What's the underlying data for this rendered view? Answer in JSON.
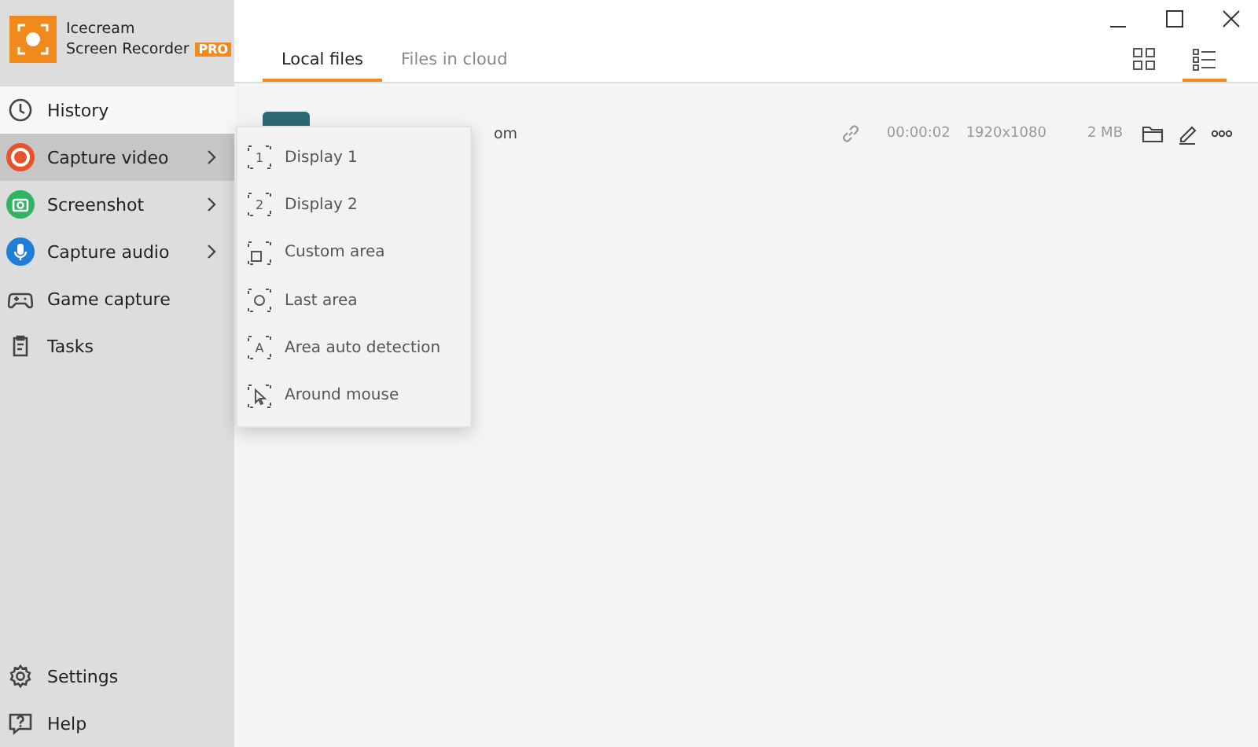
{
  "app": {
    "name_line1": "Icecream",
    "name_line2": "Screen Recorder",
    "badge": "PRO"
  },
  "sidebar": {
    "items": [
      {
        "label": "History",
        "kind": "history",
        "selected": true,
        "hovered": false,
        "submenu": false
      },
      {
        "label": "Capture video",
        "kind": "video",
        "selected": false,
        "hovered": true,
        "submenu": true
      },
      {
        "label": "Screenshot",
        "kind": "screenshot",
        "selected": false,
        "hovered": false,
        "submenu": true
      },
      {
        "label": "Capture audio",
        "kind": "audio",
        "selected": false,
        "hovered": false,
        "submenu": true
      },
      {
        "label": "Game capture",
        "kind": "game",
        "selected": false,
        "hovered": false,
        "submenu": false
      },
      {
        "label": "Tasks",
        "kind": "tasks",
        "selected": false,
        "hovered": false,
        "submenu": false
      }
    ],
    "bottom_items": [
      {
        "label": "Settings",
        "kind": "settings"
      },
      {
        "label": "Help",
        "kind": "help"
      }
    ]
  },
  "tabs": [
    {
      "label": "Local files",
      "selected": true
    },
    {
      "label": "Files in cloud",
      "selected": false
    }
  ],
  "views": [
    {
      "kind": "grid",
      "selected": false
    },
    {
      "kind": "list",
      "selected": true
    }
  ],
  "files": [
    {
      "name": "om",
      "duration": "00:00:02",
      "resolution": "1920x1080",
      "size": "2 MB"
    }
  ],
  "submenu": [
    {
      "label": "Display 1",
      "kind": "glyph",
      "glyph": "1"
    },
    {
      "label": "Display 2",
      "kind": "glyph",
      "glyph": "2"
    },
    {
      "label": "Custom area",
      "kind": "square"
    },
    {
      "label": "Last area",
      "kind": "circle"
    },
    {
      "label": "Area auto detection",
      "kind": "glyph",
      "glyph": "A"
    },
    {
      "label": "Around mouse",
      "kind": "cursor"
    }
  ]
}
